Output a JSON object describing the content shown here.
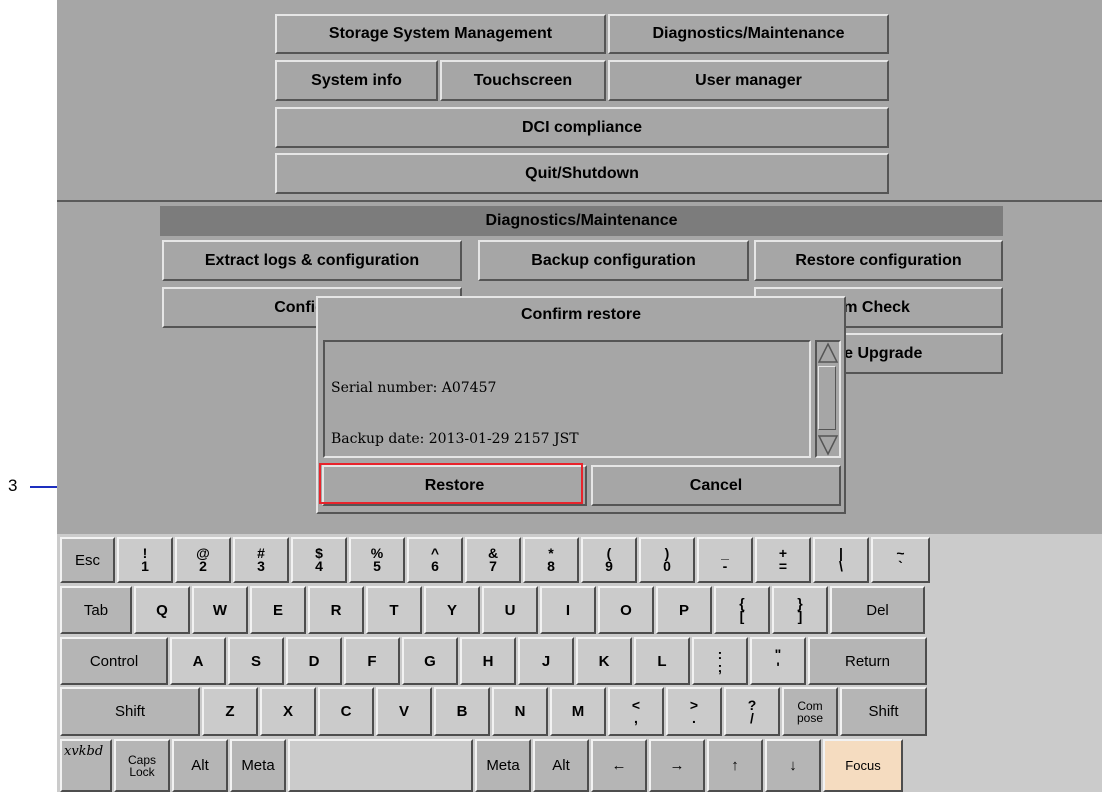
{
  "callout": {
    "label": "3"
  },
  "top_menu": {
    "storage": "Storage System Management",
    "diagnostics": "Diagnostics/Maintenance",
    "system_info": "System info",
    "touchscreen": "Touchscreen",
    "user_manager": "User manager",
    "dci": "DCI compliance",
    "quit": "Quit/Shutdown"
  },
  "diag_panel": {
    "title": "Diagnostics/Maintenance",
    "extract": "Extract logs & configuration",
    "backup": "Backup configuration",
    "restore_cfg": "Restore configuration",
    "configure": "Configure",
    "system_check": "tem Check",
    "upgrade": "are Upgrade"
  },
  "dialog": {
    "title": "Confirm restore",
    "line1": "Serial number: A07457",
    "line2": "Backup date: 2013-01-29 2157 JST",
    "restore_button": "Restore",
    "cancel_button": "Cancel"
  },
  "keyboard": {
    "row1": [
      {
        "main": "Esc"
      },
      {
        "top": "!",
        "bot": "1"
      },
      {
        "top": "@",
        "bot": "2"
      },
      {
        "top": "#",
        "bot": "3"
      },
      {
        "top": "$",
        "bot": "4"
      },
      {
        "top": "%",
        "bot": "5"
      },
      {
        "top": "^",
        "bot": "6"
      },
      {
        "top": "&",
        "bot": "7"
      },
      {
        "top": "*",
        "bot": "8"
      },
      {
        "top": "(",
        "bot": "9"
      },
      {
        "top": ")",
        "bot": "0"
      },
      {
        "top": "_",
        "bot": "-"
      },
      {
        "top": "+",
        "bot": "="
      },
      {
        "top": "|",
        "bot": "\\"
      },
      {
        "top": "~",
        "bot": "`"
      }
    ],
    "row2": [
      {
        "main": "Tab"
      },
      {
        "main": "Q"
      },
      {
        "main": "W"
      },
      {
        "main": "E"
      },
      {
        "main": "R"
      },
      {
        "main": "T"
      },
      {
        "main": "Y"
      },
      {
        "main": "U"
      },
      {
        "main": "I"
      },
      {
        "main": "O"
      },
      {
        "main": "P"
      },
      {
        "top": "{",
        "bot": "["
      },
      {
        "top": "}",
        "bot": "]"
      },
      {
        "main": "Del"
      }
    ],
    "row3": [
      {
        "main": "Control"
      },
      {
        "main": "A"
      },
      {
        "main": "S"
      },
      {
        "main": "D"
      },
      {
        "main": "F"
      },
      {
        "main": "G"
      },
      {
        "main": "H"
      },
      {
        "main": "J"
      },
      {
        "main": "K"
      },
      {
        "main": "L"
      },
      {
        "top": ":",
        "bot": ";"
      },
      {
        "top": "\"",
        "bot": "'"
      },
      {
        "main": "Return"
      }
    ],
    "row4": [
      {
        "main": "Shift"
      },
      {
        "main": "Z"
      },
      {
        "main": "X"
      },
      {
        "main": "C"
      },
      {
        "main": "V"
      },
      {
        "main": "B"
      },
      {
        "main": "N"
      },
      {
        "main": "M"
      },
      {
        "top": "<",
        "bot": ","
      },
      {
        "top": ">",
        "bot": "."
      },
      {
        "top": "?",
        "bot": "/"
      },
      {
        "top": "Com",
        "bot": "pose"
      },
      {
        "main": "Shift"
      }
    ],
    "row5": [
      {
        "main": "xvkbd"
      },
      {
        "top": "Caps",
        "bot": "Lock"
      },
      {
        "main": "Alt"
      },
      {
        "main": "Meta"
      },
      {
        "main": ""
      },
      {
        "main": "Meta"
      },
      {
        "main": "Alt"
      },
      {
        "main": "←"
      },
      {
        "main": "→"
      },
      {
        "main": "↑"
      },
      {
        "main": "↓"
      },
      {
        "main": "Focus"
      }
    ]
  },
  "colors": {
    "highlight": "#e8232b",
    "callout": "#1d2fbf",
    "focus_key": "#f5dcc0"
  }
}
